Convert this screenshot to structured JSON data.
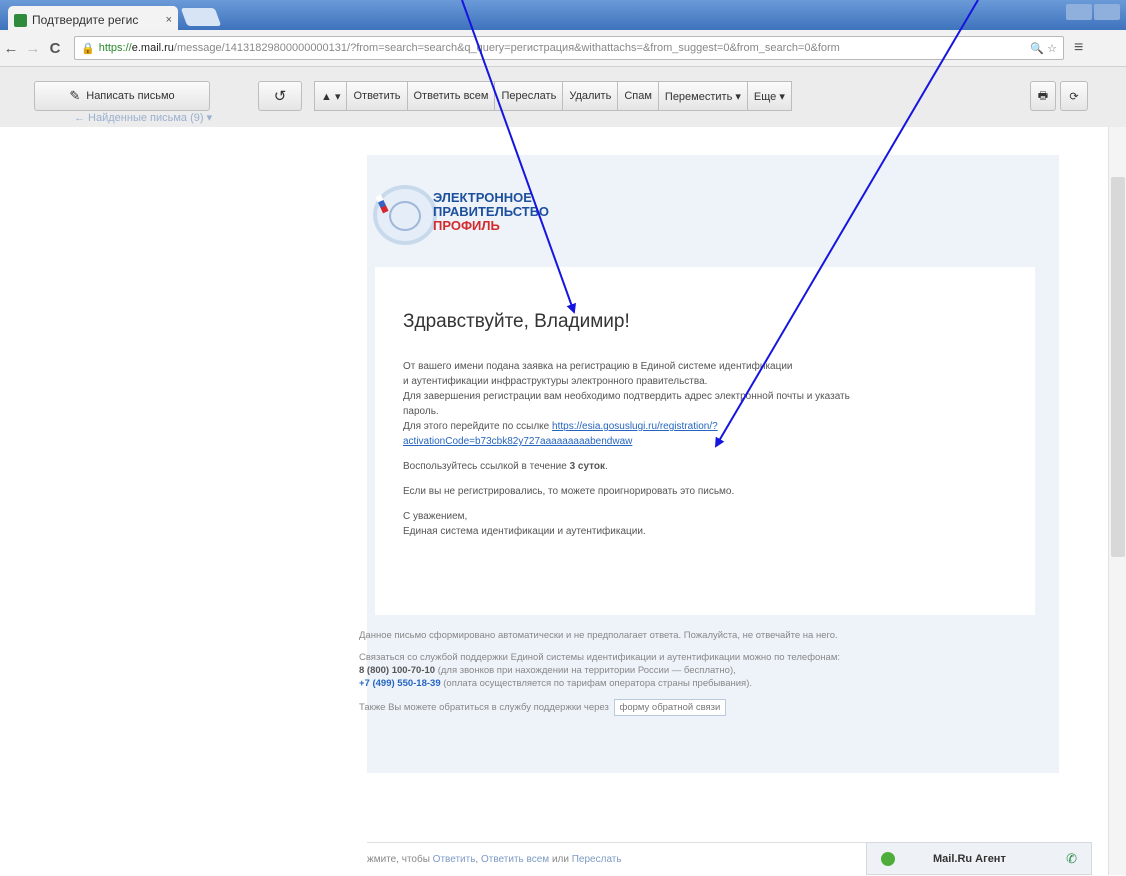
{
  "browser": {
    "tab_title": "Подтвердите регис",
    "tab_close": "×",
    "url_https": "https://",
    "url_host": "e.mail.ru",
    "url_rest": "/message/14131829800000000131/?from=search=search&q_query=регистрация&withattachs=&from_suggest=0&from_search=0&form",
    "omni_icons": "🔍 ☆",
    "menu": "≡",
    "back": "←",
    "forward": "→",
    "reload": "C"
  },
  "mail_toolbar": {
    "compose": "Написать письмо",
    "undo": "↺",
    "up_down": "▲ ▾",
    "reply": "Ответить",
    "reply_all": "Ответить всем",
    "forward": "Переслать",
    "delete": "Удалить",
    "spam": "Спам",
    "move": "Переместить ▾",
    "more": "Еще ▾",
    "breadcrumb": "← Найденные письма (9) ▾"
  },
  "logo": {
    "line1": "ЭЛЕКТРОННОЕ",
    "line2": "ПРАВИТЕЛЬСТВО",
    "line3": "ПРОФИЛЬ"
  },
  "message": {
    "greeting": "Здравствуйте, Владимир!",
    "p1_a": "От вашего имени подана заявка на регистрацию в Единой системе идентификации",
    "p1_b": "и аутентификации инфраструктуры электронного правительства.",
    "p1_c": "Для завершения регистрации вам необходимо подтвердить адрес электронной почты и указать",
    "p1_d": "пароль.",
    "p1_e": "Для этого перейдите по ссылке",
    "link_a": "https://esia.gosuslugi.ru/registration/?",
    "link_b": "activationCode=b73cbk82y727aaaaaaaaabendwaw",
    "p2_a": "Воспользуйтесь ссылкой в течение",
    "p2_b": "3 суток",
    "p2_c": ".",
    "p3": "Если вы не регистрировались, то можете проигнорировать это письмо.",
    "sign_a": "С уважением,",
    "sign_b": "Единая система идентификации и аутентификации."
  },
  "footer": {
    "f1": "Данное письмо сформировано автоматически и не предполагает ответа. Пожалуйста, не отвечайте на него.",
    "f2": "Связаться со службой поддержки Единой системы идентификации и аутентификации можно по телефонам:",
    "phone1": "8 (800) 100-70-10",
    "phone1_note": "(для звонков при нахождении на территории России — бесплатно),",
    "phone2": "+7 (499) 550-18-39",
    "phone2_note": "(оплата осуществляется по тарифам оператора страны пребывания).",
    "f3": "Также Вы можете обратиться в службу поддержки через",
    "feedback_button": "форму обратной связи"
  },
  "replybar": {
    "text_a": "жмите, чтобы",
    "reply": "Ответить",
    "sep1": ",",
    "reply_all": "Ответить всем",
    "or": "или",
    "forward": "Переслать"
  },
  "agent": {
    "label": "Mail.Ru Агент",
    "phone_icon": "✆"
  },
  "colors": {
    "arrow": "#1515e0",
    "link": "#2565c0",
    "logo_blue": "#1c4f9c",
    "logo_red": "#d22b2b"
  }
}
